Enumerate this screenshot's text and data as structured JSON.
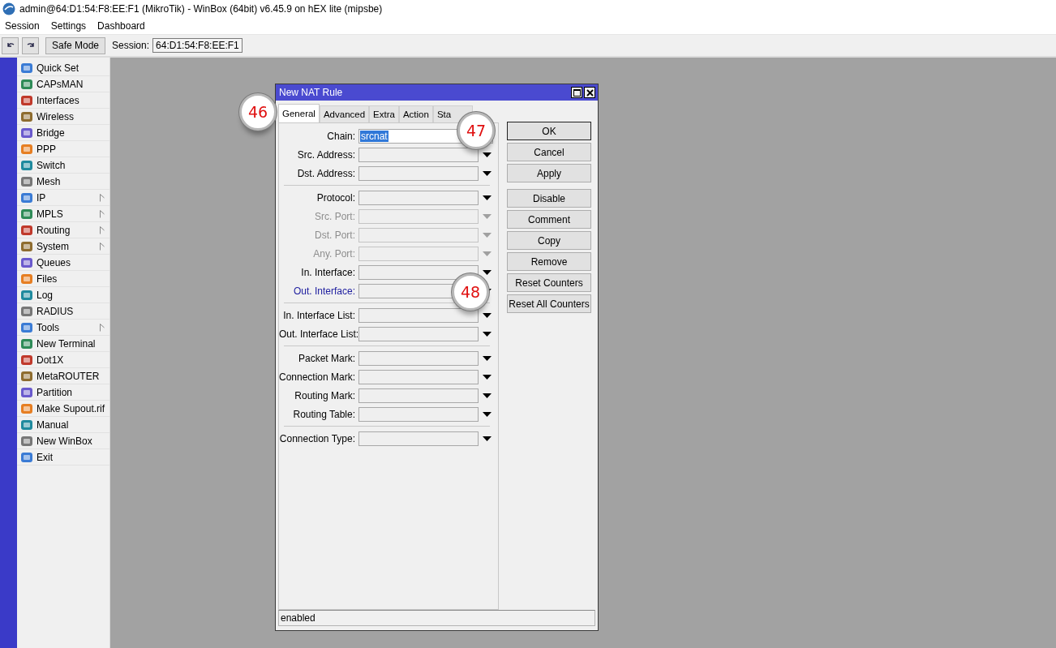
{
  "window": {
    "title": "admin@64:D1:54:F8:EE:F1 (MikroTik) - WinBox (64bit) v6.45.9 on hEX lite (mipsbe)"
  },
  "menu": [
    "Session",
    "Settings",
    "Dashboard"
  ],
  "toolbar": {
    "safe_mode": "Safe Mode",
    "session_label": "Session:",
    "session_value": "64:D1:54:F8:EE:F1"
  },
  "sidebar": {
    "items": [
      {
        "label": "Quick Set",
        "submenu": false
      },
      {
        "label": "CAPsMAN",
        "submenu": false
      },
      {
        "label": "Interfaces",
        "submenu": false
      },
      {
        "label": "Wireless",
        "submenu": false
      },
      {
        "label": "Bridge",
        "submenu": false
      },
      {
        "label": "PPP",
        "submenu": false
      },
      {
        "label": "Switch",
        "submenu": false
      },
      {
        "label": "Mesh",
        "submenu": false
      },
      {
        "label": "IP",
        "submenu": true
      },
      {
        "label": "MPLS",
        "submenu": true
      },
      {
        "label": "Routing",
        "submenu": true
      },
      {
        "label": "System",
        "submenu": true
      },
      {
        "label": "Queues",
        "submenu": false
      },
      {
        "label": "Files",
        "submenu": false
      },
      {
        "label": "Log",
        "submenu": false
      },
      {
        "label": "RADIUS",
        "submenu": false
      },
      {
        "label": "Tools",
        "submenu": true
      },
      {
        "label": "New Terminal",
        "submenu": false
      },
      {
        "label": "Dot1X",
        "submenu": false
      },
      {
        "label": "MetaROUTER",
        "submenu": false
      },
      {
        "label": "Partition",
        "submenu": false
      },
      {
        "label": "Make Supout.rif",
        "submenu": false
      },
      {
        "label": "Manual",
        "submenu": false
      },
      {
        "label": "New WinBox",
        "submenu": false
      },
      {
        "label": "Exit",
        "submenu": false
      }
    ]
  },
  "dialog": {
    "title": "New NAT Rule",
    "tabs": [
      {
        "label": "General",
        "selected": true
      },
      {
        "label": "Advanced",
        "selected": false
      },
      {
        "label": "Extra",
        "selected": false
      },
      {
        "label": "Action",
        "selected": false
      },
      {
        "label": "Sta",
        "selected": false
      }
    ],
    "groups": [
      [
        {
          "label": "Chain:",
          "kind": "combo",
          "value": "srcnat",
          "disabled": false,
          "highlighted": false
        },
        {
          "label": "Src. Address:",
          "kind": "select",
          "disabled": false,
          "highlighted": false
        },
        {
          "label": "Dst. Address:",
          "kind": "select",
          "disabled": false,
          "highlighted": false
        }
      ],
      [
        {
          "label": "Protocol:",
          "kind": "select",
          "disabled": false,
          "highlighted": false
        },
        {
          "label": "Src. Port:",
          "kind": "select",
          "disabled": true,
          "highlighted": false
        },
        {
          "label": "Dst. Port:",
          "kind": "select",
          "disabled": true,
          "highlighted": false
        },
        {
          "label": "Any. Port:",
          "kind": "select",
          "disabled": true,
          "highlighted": false
        },
        {
          "label": "In. Interface:",
          "kind": "select",
          "disabled": false,
          "highlighted": false
        },
        {
          "label": "Out. Interface:",
          "kind": "select",
          "disabled": false,
          "highlighted": true
        }
      ],
      [
        {
          "label": "In. Interface List:",
          "kind": "select",
          "disabled": false,
          "highlighted": false
        },
        {
          "label": "Out. Interface List:",
          "kind": "select",
          "disabled": false,
          "highlighted": false
        }
      ],
      [
        {
          "label": "Packet Mark:",
          "kind": "select",
          "disabled": false,
          "highlighted": false
        },
        {
          "label": "Connection Mark:",
          "kind": "select",
          "disabled": false,
          "highlighted": false
        },
        {
          "label": "Routing Mark:",
          "kind": "select",
          "disabled": false,
          "highlighted": false
        },
        {
          "label": "Routing Table:",
          "kind": "select",
          "disabled": false,
          "highlighted": false
        }
      ],
      [
        {
          "label": "Connection Type:",
          "kind": "select",
          "disabled": false,
          "highlighted": false
        }
      ]
    ],
    "button_groups": [
      [
        {
          "label": "OK",
          "default": true
        },
        {
          "label": "Cancel",
          "default": false
        },
        {
          "label": "Apply",
          "default": false
        }
      ],
      [
        {
          "label": "Disable",
          "default": false
        },
        {
          "label": "Comment",
          "default": false
        },
        {
          "label": "Copy",
          "default": false
        },
        {
          "label": "Remove",
          "default": false
        },
        {
          "label": "Reset Counters",
          "default": false
        },
        {
          "label": "Reset All Counters",
          "default": false
        }
      ]
    ],
    "status": "enabled"
  },
  "callouts": [
    {
      "number": "46"
    },
    {
      "number": "47"
    },
    {
      "number": "48"
    }
  ]
}
